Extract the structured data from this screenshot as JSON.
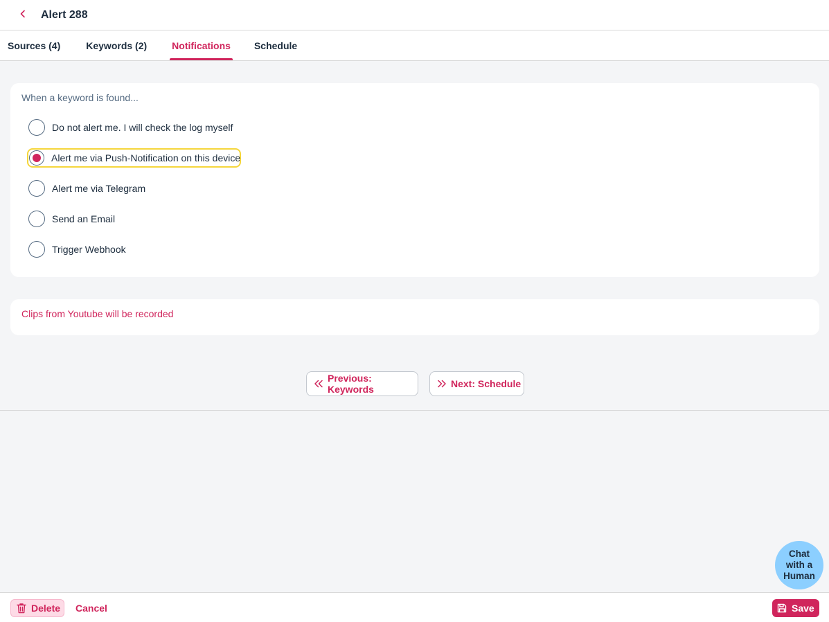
{
  "header": {
    "title": "Alert 288",
    "back_icon": "chevron-left-icon"
  },
  "tabs": [
    {
      "label": "Sources (4)",
      "active": false
    },
    {
      "label": "Keywords (2)",
      "active": false
    },
    {
      "label": "Notifications",
      "active": true
    },
    {
      "label": "Schedule",
      "active": false
    }
  ],
  "notifications": {
    "prompt": "When a keyword is found...",
    "options": [
      {
        "label": "Do not alert me. I will check the log myself",
        "selected": false
      },
      {
        "label": "Alert me via Push-Notification on this device",
        "selected": true
      },
      {
        "label": "Alert me via Telegram",
        "selected": false
      },
      {
        "label": "Send an Email",
        "selected": false
      },
      {
        "label": "Trigger Webhook",
        "selected": false
      }
    ]
  },
  "info": {
    "text": "Clips from Youtube will be recorded"
  },
  "navigation": {
    "previous_label": "Previous: Keywords",
    "next_label": "Next: Schedule"
  },
  "chat": {
    "label_line1": "Chat",
    "label_line2": "with a",
    "label_line3": "Human"
  },
  "footer": {
    "delete_label": "Delete",
    "cancel_label": "Cancel",
    "save_label": "Save"
  },
  "colors": {
    "accent": "#d0255c",
    "focus": "#f5d63c",
    "chat_bubble": "#8ccfff",
    "background": "#f4f5f7"
  }
}
